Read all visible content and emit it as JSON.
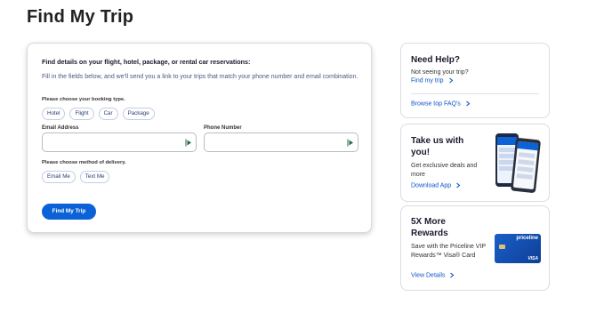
{
  "page": {
    "title": "Find My Trip"
  },
  "form": {
    "heading": "Find details on your flight, hotel, package, or rental car reservations:",
    "intro": "Fill in the fields below, and we'll send you a link to your trips that match your phone number and email combination.",
    "booking_type_label": "Please choose your booking type.",
    "booking_types": [
      "Hotel",
      "Flight",
      "Car",
      "Package"
    ],
    "email_label": "Email Address",
    "email_value": "",
    "phone_label": "Phone Number",
    "phone_value": "",
    "delivery_label": "Please choose method of delivery.",
    "delivery_methods": [
      "Email Me",
      "Text Me"
    ],
    "submit_label": "Find My Trip"
  },
  "help": {
    "title": "Need Help?",
    "text": "Not seeing your trip?",
    "link": "Find my trip",
    "link2": "Browse top FAQ's"
  },
  "app": {
    "title": "Take us with you!",
    "text": "Get exclusive deals and more",
    "link": "Download App"
  },
  "rewards": {
    "title": "5X More Rewards",
    "text": "Save with the Priceline VIP Rewards™ Visa® Card",
    "link": "View Details",
    "card_brand": "priceline",
    "card_network": "VISA"
  },
  "colors": {
    "primary": "#0a62d6",
    "link": "#0a55c8",
    "card_blue": "#1450b8"
  },
  "icons": {
    "field_icon": "autofill-arrow-icon",
    "chevron": "chevron-right-icon"
  }
}
